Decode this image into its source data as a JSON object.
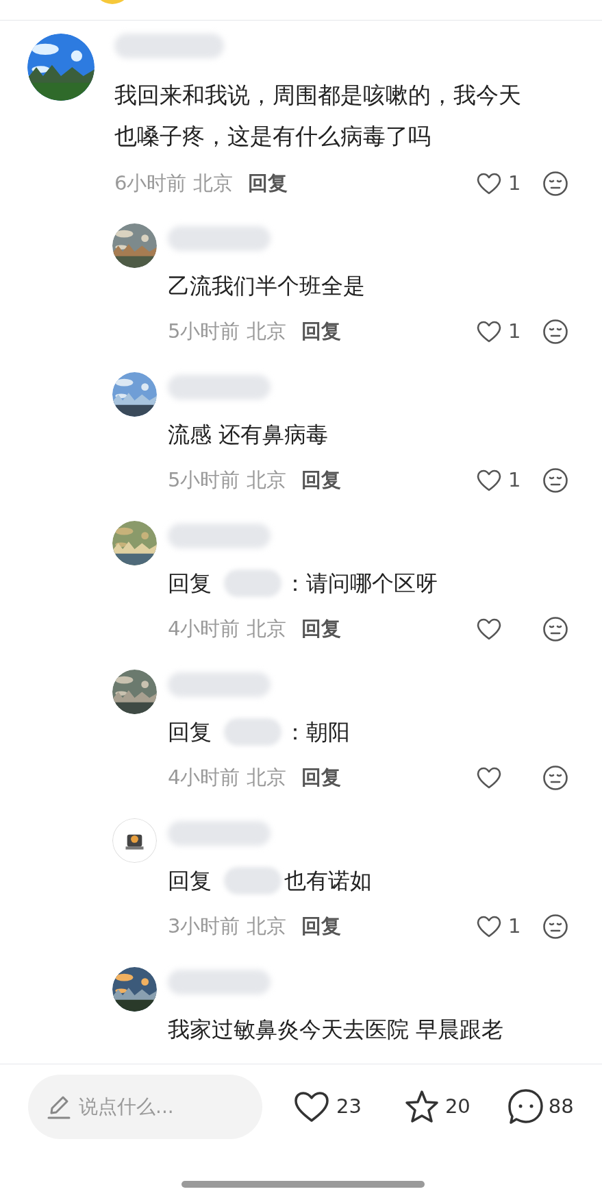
{
  "comments": [
    {
      "kind": "comment",
      "text": "我回来和我说，周围都是咳嗽的，我今天也嗓子疼，这是有什么病毒了吗",
      "time": "6小时前",
      "location": "北京",
      "reply_label": "回复",
      "likes": "1"
    },
    {
      "kind": "reply",
      "text": "乙流我们半个班全是",
      "time": "5小时前",
      "location": "北京",
      "reply_label": "回复",
      "likes": "1"
    },
    {
      "kind": "reply",
      "text": "流感 还有鼻病毒",
      "time": "5小时前",
      "location": "北京",
      "reply_label": "回复",
      "likes": "1"
    },
    {
      "kind": "reply",
      "reply_prefix": "回复",
      "text": "：请问哪个区呀",
      "time": "4小时前",
      "location": "北京",
      "reply_label": "回复"
    },
    {
      "kind": "reply",
      "reply_prefix": "回复",
      "text": "：朝阳",
      "time": "4小时前",
      "location": "北京",
      "reply_label": "回复"
    },
    {
      "kind": "reply",
      "reply_prefix": "回复",
      "text": "也有诺如",
      "time": "3小时前",
      "location": "北京",
      "reply_label": "回复",
      "likes": "1"
    },
    {
      "kind": "reply",
      "text": "我家过敏鼻炎今天去医院 早晨跟老"
    }
  ],
  "bottom_bar": {
    "placeholder": "说点什么...",
    "likes": "23",
    "favorites": "20",
    "comments": "88"
  }
}
